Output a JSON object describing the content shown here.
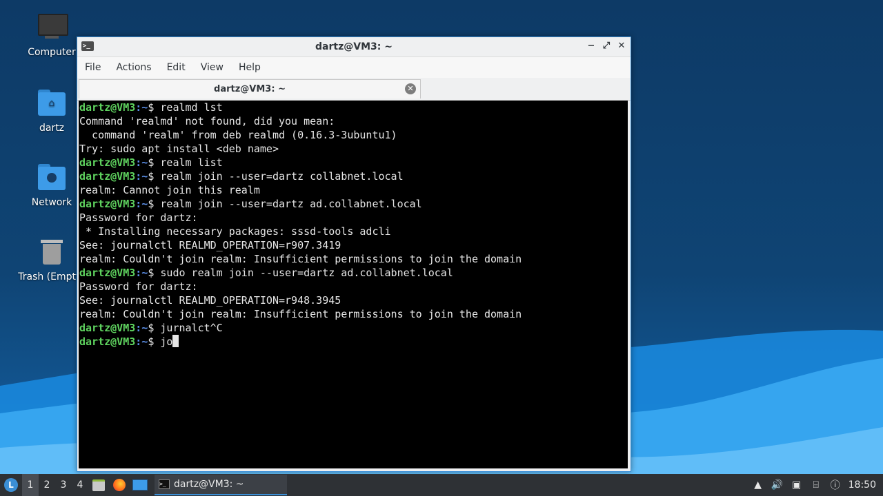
{
  "desktop": {
    "icons": [
      {
        "label": "Computer",
        "icon": "monitor-icon"
      },
      {
        "label": "dartz",
        "icon": "home-folder-icon"
      },
      {
        "label": "Network",
        "icon": "network-folder-icon"
      },
      {
        "label": "Trash (Empty)",
        "icon": "trash-icon"
      }
    ]
  },
  "window": {
    "title": "dartz@VM3: ~",
    "menu": [
      "File",
      "Actions",
      "Edit",
      "View",
      "Help"
    ],
    "tab_label": "dartz@VM3: ~",
    "controls": {
      "minimize": "−",
      "maximize": "⤢",
      "close": "✕"
    }
  },
  "terminal": {
    "prompt_user": "dartz@VM3",
    "prompt_path": ":~",
    "prompt_symbol": "$ ",
    "lines": [
      {
        "type": "cmd",
        "text": "realmd lst"
      },
      {
        "type": "out",
        "text": "Command 'realmd' not found, did you mean:"
      },
      {
        "type": "out",
        "text": "  command 'realm' from deb realmd (0.16.3-3ubuntu1)"
      },
      {
        "type": "out",
        "text": "Try: sudo apt install <deb name>"
      },
      {
        "type": "cmd",
        "text": "realm list"
      },
      {
        "type": "cmd",
        "text": "realm join --user=dartz collabnet.local"
      },
      {
        "type": "out",
        "text": "realm: Cannot join this realm"
      },
      {
        "type": "cmd",
        "text": "realm join --user=dartz ad.collabnet.local"
      },
      {
        "type": "out",
        "text": "Password for dartz:"
      },
      {
        "type": "out",
        "text": " * Installing necessary packages: sssd-tools adcli"
      },
      {
        "type": "out",
        "text": "See: journalctl REALMD_OPERATION=r907.3419"
      },
      {
        "type": "out",
        "text": "realm: Couldn't join realm: Insufficient permissions to join the domain"
      },
      {
        "type": "cmd",
        "text": "sudo realm join --user=dartz ad.collabnet.local"
      },
      {
        "type": "out",
        "text": "Password for dartz:"
      },
      {
        "type": "out",
        "text": "See: journalctl REALMD_OPERATION=r948.3945"
      },
      {
        "type": "out",
        "text": "realm: Couldn't join realm: Insufficient permissions to join the domain"
      },
      {
        "type": "cmd",
        "text": "jurnalct^C"
      },
      {
        "type": "current",
        "text": "jo"
      }
    ]
  },
  "taskbar": {
    "start_icon": "lubuntu-logo-icon",
    "workspaces": [
      "1",
      "2",
      "3",
      "4"
    ],
    "active_workspace": "1",
    "launchers": [
      "file-manager-icon",
      "firefox-icon",
      "show-desktop-icon"
    ],
    "task_label": "dartz@VM3: ~",
    "tray_icons": [
      "tray-expand-icon",
      "volume-icon",
      "clipboard-icon",
      "network-icon",
      "notification-icon"
    ],
    "clock": "18:50"
  },
  "colors": {
    "accent": "#3b8fd6",
    "prompt_user": "#5fd35f",
    "prompt_path": "#5b8fe8",
    "terminal_bg": "#000000"
  }
}
